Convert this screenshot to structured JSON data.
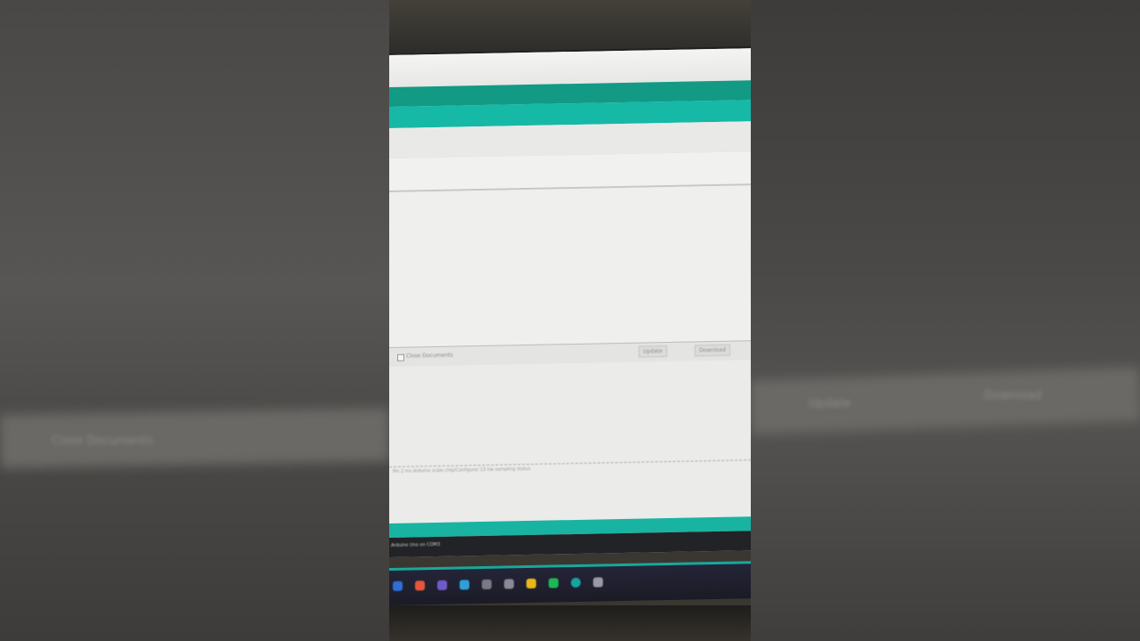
{
  "background": {
    "left_blur_text": "Close Documents",
    "right_blur_text_a": "Update",
    "right_blur_text_b": "Download"
  },
  "ide": {
    "status_row": {
      "checkbox_label": "Close Documents",
      "button_1": "Update",
      "button_2": "Download"
    },
    "console_line": "Pin 2 ms Arduino scale chip/Configure/ 13 hw sampling status",
    "status_bar_text": "Arduino Uno on COM3"
  },
  "colors": {
    "menubar": "#129a85",
    "toolbar": "#16b8a6",
    "taskbar": "#1b1b26"
  },
  "taskbar_icons": [
    {
      "name": "start-icon",
      "color": "#2f6fd6"
    },
    {
      "name": "firefox-icon",
      "color": "#e3573a"
    },
    {
      "name": "app-icon",
      "color": "#6f5ac8"
    },
    {
      "name": "edge-icon",
      "color": "#2ea0d8"
    },
    {
      "name": "files-icon",
      "color": "#7a7a86"
    },
    {
      "name": "store-icon",
      "color": "#8a8a96"
    },
    {
      "name": "folder-icon",
      "color": "#e8b71a"
    },
    {
      "name": "spotify-icon",
      "color": "#1db954"
    },
    {
      "name": "arduino-icon",
      "color": "#18a3a0"
    },
    {
      "name": "network-icon",
      "color": "#9a9aa6"
    }
  ]
}
